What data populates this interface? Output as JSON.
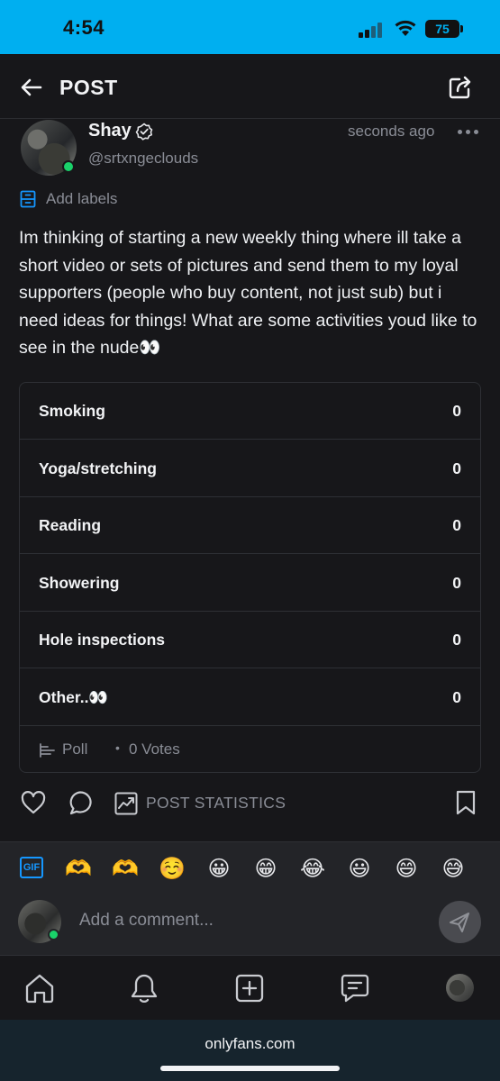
{
  "status_bar": {
    "time": "4:54",
    "battery": "75"
  },
  "header": {
    "title": "POST"
  },
  "post": {
    "author_name": "Shay",
    "author_handle": "@srtxngeclouds",
    "timestamp": "seconds ago",
    "add_labels": "Add labels",
    "text": "Im thinking of starting a new weekly thing where ill take a short video or sets of pictures and send them to my loyal supporters (people who buy content, not just sub) but i need ideas for things! What are some activities youd like to see in the nude👀"
  },
  "poll": {
    "options": [
      {
        "label": "Smoking",
        "count": "0"
      },
      {
        "label": "Yoga/stretching",
        "count": "0"
      },
      {
        "label": "Reading",
        "count": "0"
      },
      {
        "label": "Showering",
        "count": "0"
      },
      {
        "label": "Hole inspections",
        "count": "0"
      },
      {
        "label": "Other..👀",
        "count": "0"
      }
    ],
    "footer_label": "Poll",
    "separator": "•",
    "votes": "0 Votes"
  },
  "actions": {
    "post_statistics": "POST STATISTICS"
  },
  "composer": {
    "gif_label": "GIF",
    "emojis": [
      "🫶",
      "🫶",
      "☺️",
      "😀",
      "😁",
      "😂",
      "😃",
      "😄",
      "😅"
    ],
    "placeholder": "Add a comment..."
  },
  "browser": {
    "url": "onlyfans.com"
  },
  "colors": {
    "brand_blue": "#00aff0",
    "online_green": "#1ad26a",
    "background": "#17171a",
    "accent_blue": "#1597ff"
  },
  "icons": [
    "back-arrow-icon",
    "share-icon",
    "verified-icon",
    "more-icon",
    "label-icon",
    "poll-icon",
    "heart-icon",
    "comment-icon",
    "stats-icon",
    "bookmark-icon",
    "send-icon",
    "home-icon",
    "bell-icon",
    "add-icon",
    "messages-icon"
  ]
}
